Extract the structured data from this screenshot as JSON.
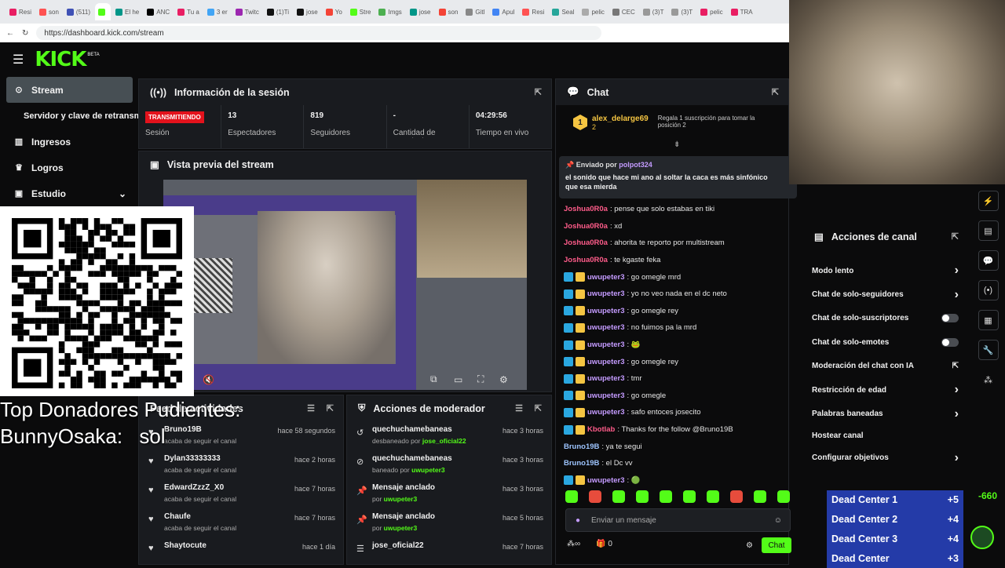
{
  "browser": {
    "tabs": [
      "Resi",
      "son",
      "(511)",
      "",
      "El he",
      "ANC",
      "Tu a",
      "3 er",
      "Twitc",
      "(1)Ti",
      "jose",
      "Yo",
      "Stre",
      "Imgs",
      "jose",
      "son",
      "Gitl",
      "Apul",
      "Resi",
      "Seal",
      "pelic",
      "CEC",
      "(3)T",
      "(3)T",
      "pelic",
      "TRA"
    ],
    "url": "https://dashboard.kick.com/stream"
  },
  "header": {
    "logo": "KICK",
    "beta": "BETA"
  },
  "sidebar": {
    "items": [
      {
        "label": "Stream",
        "icon": "radio-icon"
      },
      {
        "label": "Servidor y clave de retransm",
        "icon": ""
      },
      {
        "label": "Ingresos",
        "icon": "chart-icon"
      },
      {
        "label": "Logros",
        "icon": "trophy-icon"
      },
      {
        "label": "Estudio",
        "icon": "studio-icon"
      }
    ]
  },
  "session": {
    "title": "Información de la sesión",
    "live_badge": "TRANSMITIENDO",
    "session_label": "Sesión",
    "stats": [
      {
        "value": "13",
        "label": "Espectadores"
      },
      {
        "value": "819",
        "label": "Seguidores"
      },
      {
        "value": "-",
        "label": "Cantidad de suscripciones"
      },
      {
        "value": "04:29:56",
        "label": "Tiempo en vivo"
      }
    ]
  },
  "preview": {
    "title": "Vista previa del stream"
  },
  "activity": {
    "title": "Feed de actividades",
    "items": [
      {
        "name": "Bruno19B",
        "sub": "acaba de seguir el canal",
        "time": "hace 58 segundos"
      },
      {
        "name": "Dylan33333333",
        "sub": "acaba de seguir el canal",
        "time": "hace 2 horas"
      },
      {
        "name": "EdwardZzzZ_X0",
        "sub": "acaba de seguir el canal",
        "time": "hace 7 horas"
      },
      {
        "name": "Chaufe",
        "sub": "acaba de seguir el canal",
        "time": "hace 7 horas"
      },
      {
        "name": "Shaytocute",
        "sub": "",
        "time": "hace 1 día"
      }
    ]
  },
  "modactions": {
    "title": "Acciones de moderador",
    "items": [
      {
        "icon": "undo-icon",
        "name": "quechuchamebaneas",
        "sub": "desbaneado por",
        "by": "jose_oficial22",
        "time": "hace 3 horas"
      },
      {
        "icon": "ban-icon",
        "name": "quechuchamebaneas",
        "sub": "baneado por",
        "by": "uwupeter3",
        "time": "hace 3 horas"
      },
      {
        "icon": "pin-icon",
        "name": "Mensaje anclado",
        "sub": "por",
        "by": "uwupeter3",
        "time": "hace 3 horas"
      },
      {
        "icon": "pin-icon",
        "name": "Mensaje anclado",
        "sub": "por",
        "by": "uwupeter3",
        "time": "hace 5 horas"
      },
      {
        "icon": "list-icon",
        "name": "jose_oficial22",
        "sub": "",
        "by": "",
        "time": "hace 7 horas"
      }
    ]
  },
  "chat": {
    "title": "Chat",
    "top_user": "alex_delarge69",
    "top_count": "2",
    "gift_text": "Regala 1 suscripción para tomar la posición 2",
    "pinned_by_label": "Enviado por",
    "pinned_user": "polpot324",
    "pinned_text": "el sonido que hace mi ano al soltar la caca es más sinfónico que esa mierda",
    "messages": [
      {
        "user": "Joshua0R0a",
        "cls": "r",
        "text": ": pense que solo estabas en tiki",
        "badges": 0
      },
      {
        "user": "Joshua0R0a",
        "cls": "r",
        "text": ": xd",
        "badges": 0
      },
      {
        "user": "Joshua0R0a",
        "cls": "r",
        "text": ": ahorita te reporto por multistream",
        "badges": 0
      },
      {
        "user": "Joshua0R0a",
        "cls": "r",
        "text": ": te kgaste feka",
        "badges": 0
      },
      {
        "user": "uwupeter3",
        "cls": "",
        "text": ": go omegle mrd",
        "badges": 2
      },
      {
        "user": "uwupeter3",
        "cls": "",
        "text": ": yo no veo nada en el dc neto",
        "badges": 2
      },
      {
        "user": "uwupeter3",
        "cls": "",
        "text": ": go omegle rey",
        "badges": 2
      },
      {
        "user": "uwupeter3",
        "cls": "",
        "text": ": no fuimos pa la mrd",
        "badges": 2
      },
      {
        "user": "uwupeter3",
        "cls": "",
        "text": ": 🐸",
        "badges": 2
      },
      {
        "user": "uwupeter3",
        "cls": "",
        "text": ": go omegle rey",
        "badges": 2
      },
      {
        "user": "uwupeter3",
        "cls": "",
        "text": ": tmr",
        "badges": 2
      },
      {
        "user": "uwupeter3",
        "cls": "",
        "text": ": go omegle",
        "badges": 2
      },
      {
        "user": "uwupeter3",
        "cls": "",
        "text": ": safo entoces josecito",
        "badges": 2
      },
      {
        "user": "Kbotlab",
        "cls": "r",
        "text": ": Thanks for the follow @Bruno19B",
        "badges": 2
      },
      {
        "user": "Bruno19B",
        "cls": "b",
        "text": ": ya te segui",
        "badges": 0
      },
      {
        "user": "Bruno19B",
        "cls": "b",
        "text": ": el Dc vv",
        "badges": 0
      },
      {
        "user": "uwupeter3",
        "cls": "",
        "text": ": 🟢",
        "badges": 2
      }
    ],
    "input_placeholder": "Enviar un mensaje",
    "viewers_count": "0",
    "send_label": "Chat"
  },
  "channel_actions": {
    "title": "Acciones de canal",
    "items": [
      {
        "label": "Modo lento",
        "ctl": "arrow"
      },
      {
        "label": "Chat de solo-seguidores",
        "ctl": "arrow"
      },
      {
        "label": "Chat de solo-suscriptores",
        "ctl": "toggle"
      },
      {
        "label": "Chat de solo-emotes",
        "ctl": "toggle"
      },
      {
        "label": "Moderación del chat con IA",
        "ctl": "ext"
      },
      {
        "label": "Restricción de edad",
        "ctl": "arrow"
      },
      {
        "label": "Palabras baneadas",
        "ctl": "arrow"
      },
      {
        "label": "Hostear canal",
        "ctl": "none"
      },
      {
        "label": "Configurar objetivos",
        "ctl": "arrow"
      }
    ]
  },
  "overlay": {
    "donors_title": "Top Donadores Pudientes:",
    "donors_line": "BunnyOsaka:",
    "donors_suffix": "sol",
    "leaderboard": [
      {
        "name": "Dead Center 1",
        "delta": "+5"
      },
      {
        "name": "Dead Center 2",
        "delta": "+4"
      },
      {
        "name": "Dead Center 3",
        "delta": "+4"
      },
      {
        "name": "Dead Center",
        "delta": "+3"
      }
    ],
    "score": "-660"
  },
  "colors": {
    "kick_green": "#53fc18",
    "live_red": "#e3121c",
    "panel_bg": "#191b1f"
  }
}
